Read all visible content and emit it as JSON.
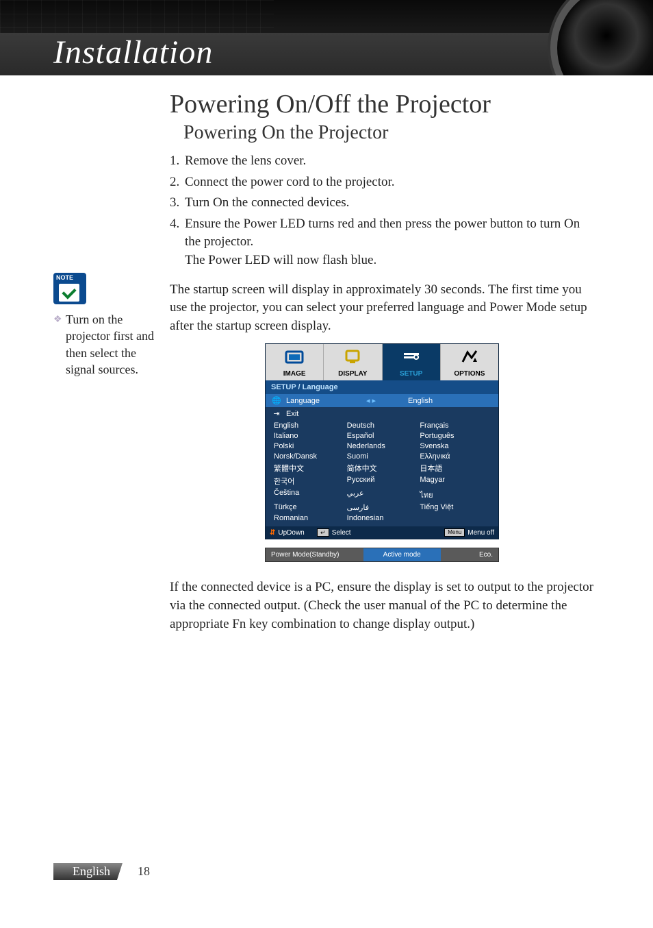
{
  "header": {
    "title": "Installation"
  },
  "main": {
    "h1": "Powering On/Off the Projector",
    "h2": "Powering On the Projector",
    "steps": [
      {
        "n": "1.",
        "t": "Remove the lens cover."
      },
      {
        "n": "2.",
        "t": "Connect the power cord to the projector."
      },
      {
        "n": "3.",
        "t": "Turn On the connected devices."
      },
      {
        "n": "4.",
        "t": "Ensure the Power LED turns red and then press the power button to turn On the projector.\nThe Power LED will now flash blue."
      }
    ],
    "para1": "The startup screen will display in approximately 30 seconds. The first time you use the projector, you can select your preferred language and Power Mode setup after the startup screen display.",
    "para2": "If the connected device is a PC, ensure the display is set to output to the projector via the connected output. (Check the user manual of the PC to determine the appropriate Fn key combination to change display output.)"
  },
  "sidebar": {
    "note_label": "NOTE",
    "tip": "Turn on the projector first and then select the signal sources."
  },
  "osd": {
    "tabs": [
      {
        "label": "IMAGE",
        "active": false
      },
      {
        "label": "DISPLAY",
        "active": false
      },
      {
        "label": "SETUP",
        "active": true
      },
      {
        "label": "OPTIONS",
        "active": false
      }
    ],
    "breadcrumb": "SETUP / Language",
    "language_row": {
      "label": "Language",
      "value": "English"
    },
    "exit_row": {
      "label": "Exit"
    },
    "languages": [
      "English",
      "Deutsch",
      "Français",
      "Italiano",
      "Español",
      "Português",
      "Polski",
      "Nederlands",
      "Svenska",
      "Norsk/Dansk",
      "Suomi",
      "Ελληνικά",
      "繁體中文",
      "简体中文",
      "日本語",
      "한국어",
      "Русский",
      "Magyar",
      "Čeština",
      "عربي",
      "ไทย",
      "Türkçe",
      "فارسی",
      "Tiếng Việt",
      "Romanian",
      "Indonesian"
    ],
    "footer": {
      "updown": "UpDown",
      "select": "Select",
      "menu_btn": "Menu",
      "menuoff": "Menu off"
    },
    "power_mode": {
      "label": "Power Mode(Standby)",
      "active": "Active mode",
      "eco": "Eco."
    }
  },
  "footer": {
    "language": "English",
    "page": "18"
  }
}
